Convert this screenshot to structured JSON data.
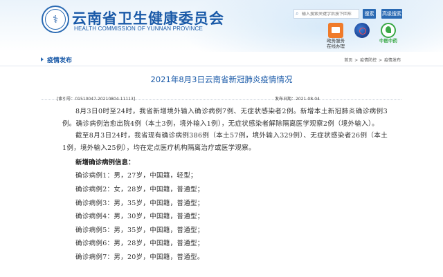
{
  "header": {
    "site_title": "云南省卫生健康委员会",
    "site_subtitle": "HEALTH COMMISSION OF YUNNAN PROVINCE",
    "emblem_icon": "health-emblem-icon",
    "search_placeholder": "输入搜索关键字后按下回车",
    "search_button": "搜索",
    "advanced_button": "高级搜索",
    "quick_links": [
      {
        "label_line1": "政务服务",
        "label_line2": "在线办理",
        "icon": "government-service-icon"
      },
      {
        "label_line1": "",
        "label_line2": "",
        "icon": "covid-info-icon"
      },
      {
        "label_line1": "",
        "label_line2": "中医中药",
        "icon": "tcm-leaf-icon"
      }
    ]
  },
  "nav": {
    "section_label": "疫情发布",
    "breadcrumb": [
      "首页",
      ">",
      "疫情防控",
      ">",
      "疫情发布"
    ]
  },
  "article": {
    "title": "2021年8月3日云南省新冠肺炎疫情情况",
    "index_label": "[索引号：01510047-20210804-11113]",
    "date_label": "发布日期：2021-08-04",
    "paragraphs": [
      "8月3日0时至24时，我省新增境外输入确诊病例7例、无症状感染者2例。新增本土新冠肺炎确诊病例3例。确诊病例治愈出院4例（本土3例，境外输入1例），无症状感染者解除隔离医学观察2例（境外输入）。",
      "截至8月3日24时，我省现有确诊病例386例（本土57例，境外输入329例）、无症状感染者26例（本土1例，境外输入25例），均在定点医疗机构隔离治疗或医学观察。"
    ],
    "subheading": "新增确诊病例信息：",
    "cases": [
      "确诊病例1：男，27岁，中国籍，轻型；",
      "确诊病例2：女，28岁，中国籍，普通型；",
      "确诊病例3：男，35岁，中国籍，普通型；",
      "确诊病例4：男，30岁，中国籍，普通型；",
      "确诊病例5：男，35岁，中国籍，普通型；",
      "确诊病例6：男，28岁，中国籍，普通型；",
      "确诊病例7：男，20岁，中国籍，普通型。"
    ]
  },
  "colors": {
    "brand_blue": "#1a5aa8",
    "button_blue": "#2a6ab3",
    "text": "#333333"
  }
}
